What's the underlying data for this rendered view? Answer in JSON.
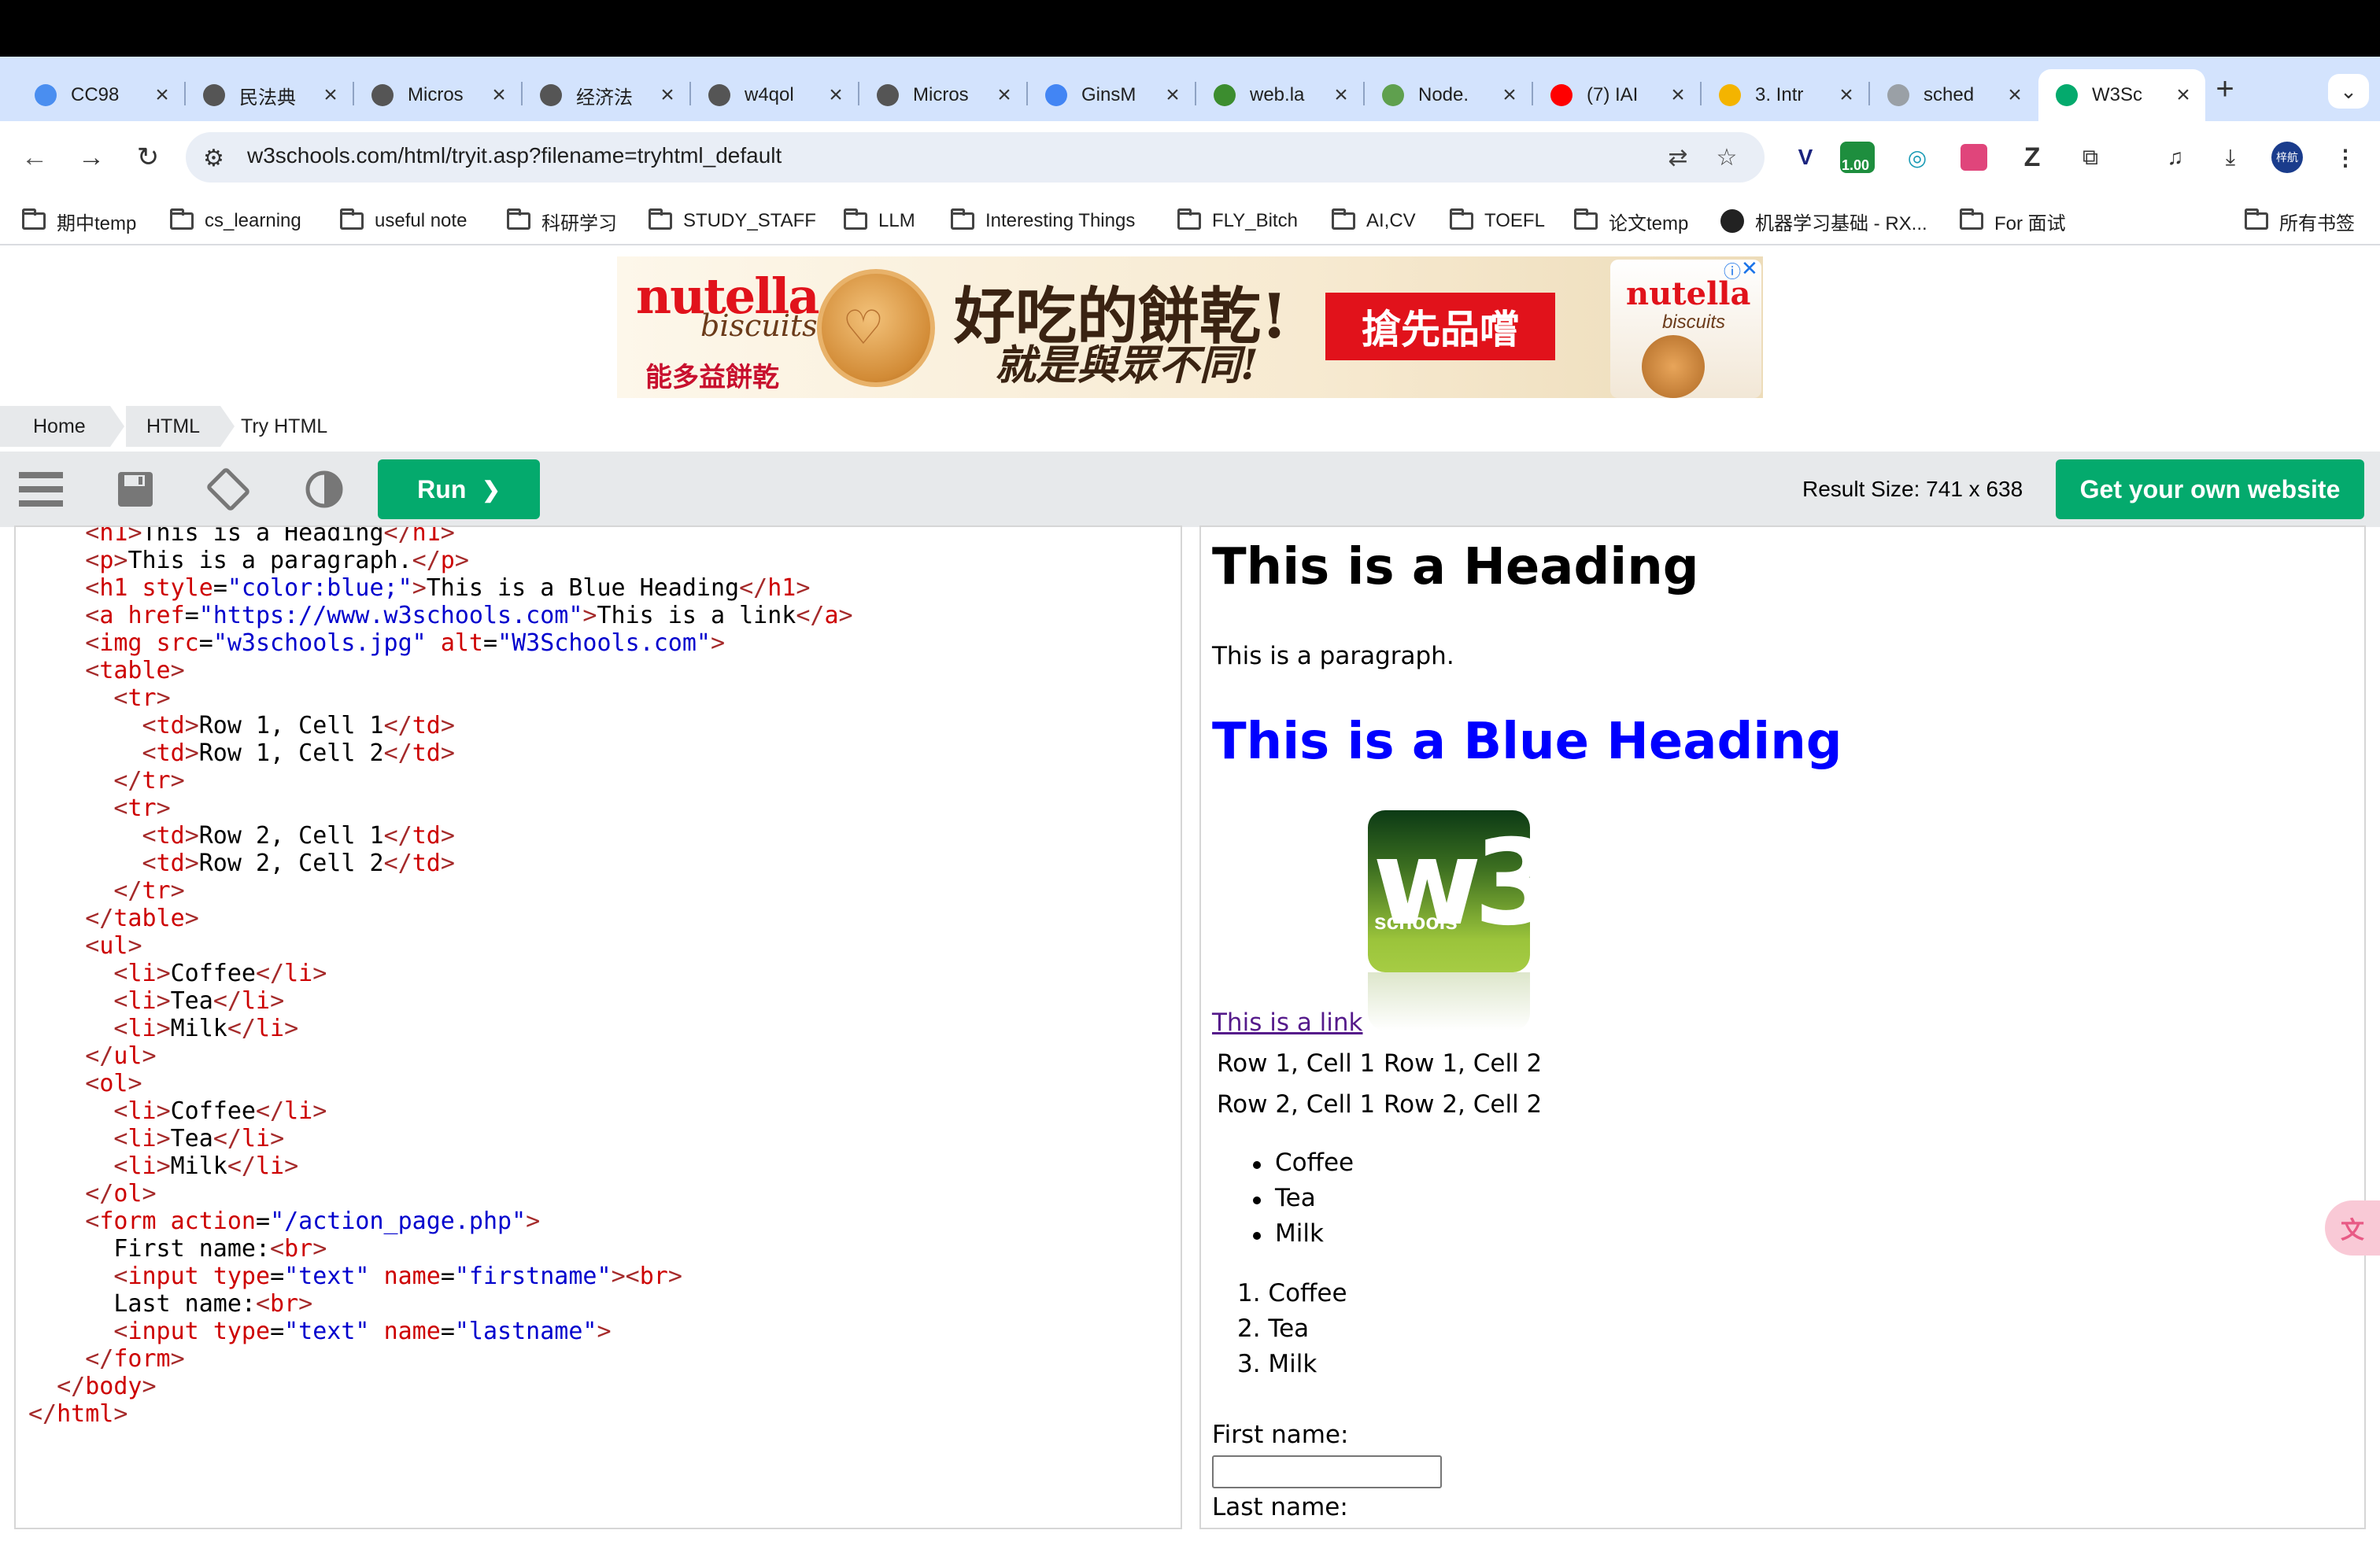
{
  "browser": {
    "tabs": [
      {
        "label": "CC98",
        "icon": "cc98-icon",
        "color": "#4a8ef0"
      },
      {
        "label": "民法典",
        "icon": "globe-icon",
        "color": "#555555"
      },
      {
        "label": "Micros",
        "icon": "globe-icon",
        "color": "#555555"
      },
      {
        "label": "经济法",
        "icon": "globe-icon",
        "color": "#555555"
      },
      {
        "label": "w4qol",
        "icon": "globe-icon",
        "color": "#555555"
      },
      {
        "label": "Micros",
        "icon": "globe-icon",
        "color": "#555555"
      },
      {
        "label": "GinsM",
        "icon": "google-icon",
        "color": "#4285f4"
      },
      {
        "label": "web.la",
        "icon": "leaf-icon",
        "color": "#3c8d2f"
      },
      {
        "label": "Node.",
        "icon": "nodejs-icon",
        "color": "#5fa04e"
      },
      {
        "label": "(7) IAI",
        "icon": "youtube-icon",
        "color": "#ff0000"
      },
      {
        "label": "3. Intr",
        "icon": "slides-icon",
        "color": "#f4b400"
      },
      {
        "label": "sched",
        "icon": "doc-icon",
        "color": "#9aa0a6"
      },
      {
        "label": "W3Sc",
        "icon": "w3schools-icon",
        "color": "#04aa6d"
      }
    ],
    "url": "w3schools.com/html/tryit.asp?filename=tryhtml_default",
    "extension_badge": "1.00",
    "profile_initials": "梓航",
    "bookmarks": [
      "期中temp",
      "cs_learning",
      "useful note",
      "科研学习",
      "STUDY_STAFF",
      "LLM",
      "Interesting Things",
      "FLY_Bitch",
      "AI,CV",
      "TOEFL",
      "论文temp",
      "机器学习基础 - RX...",
      "For 面试"
    ],
    "all_bookmarks": "所有书签"
  },
  "ad": {
    "brand_main": "nutella",
    "brand_sub": "biscuits",
    "sub_text": "能多益餅乾",
    "headline": "好吃的餅乾!",
    "tagline": "就是與眾不同!",
    "cta": "搶先品嚐",
    "pack_brand": "nutella",
    "pack_sub": "biscuits"
  },
  "breadcrumb": {
    "home": "Home",
    "html": "HTML",
    "current": "Try HTML"
  },
  "editor": {
    "run_label": "Run",
    "run_arrow": "❯",
    "result_size": "Result Size: 741 x 638",
    "get_site": "Get your own website"
  },
  "code_lines": [
    "    <h1>This is a Heading</h1>",
    "    <p>This is a paragraph.</p>",
    "    <h1 style=\"color:blue;\">This is a Blue Heading</h1>",
    "    <a href=\"https://www.w3schools.com\">This is a link</a>",
    "    <img src=\"w3schools.jpg\" alt=\"W3Schools.com\">",
    "    <table>",
    "      <tr>",
    "        <td>Row 1, Cell 1</td>",
    "        <td>Row 1, Cell 2</td>",
    "      </tr>",
    "      <tr>",
    "        <td>Row 2, Cell 1</td>",
    "        <td>Row 2, Cell 2</td>",
    "      </tr>",
    "    </table>",
    "    <ul>",
    "      <li>Coffee</li>",
    "      <li>Tea</li>",
    "      <li>Milk</li>",
    "    </ul>",
    "    <ol>",
    "      <li>Coffee</li>",
    "      <li>Tea</li>",
    "      <li>Milk</li>",
    "    </ol>",
    "    <form action=\"/action_page.php\">",
    "      First name:<br>",
    "      <input type=\"text\" name=\"firstname\"><br>",
    "      Last name:<br>",
    "      <input type=\"text\" name=\"lastname\">",
    "    </form>",
    "  </body>",
    "</html>"
  ],
  "result": {
    "heading": "This is a Heading",
    "paragraph": "This is a paragraph.",
    "blue_heading": "This is a Blue Heading",
    "blue_color": "#0000ff",
    "logo_text": "schools",
    "link": "This is a link",
    "table": [
      [
        "Row 1, Cell 1",
        "Row 1, Cell 2"
      ],
      [
        "Row 2, Cell 1",
        "Row 2, Cell 2"
      ]
    ],
    "ul": [
      "Coffee",
      "Tea",
      "Milk"
    ],
    "ol": [
      "1. Coffee",
      "2. Tea",
      "3. Milk"
    ],
    "first_name_label": "First name:",
    "last_name_label": "Last name:"
  }
}
